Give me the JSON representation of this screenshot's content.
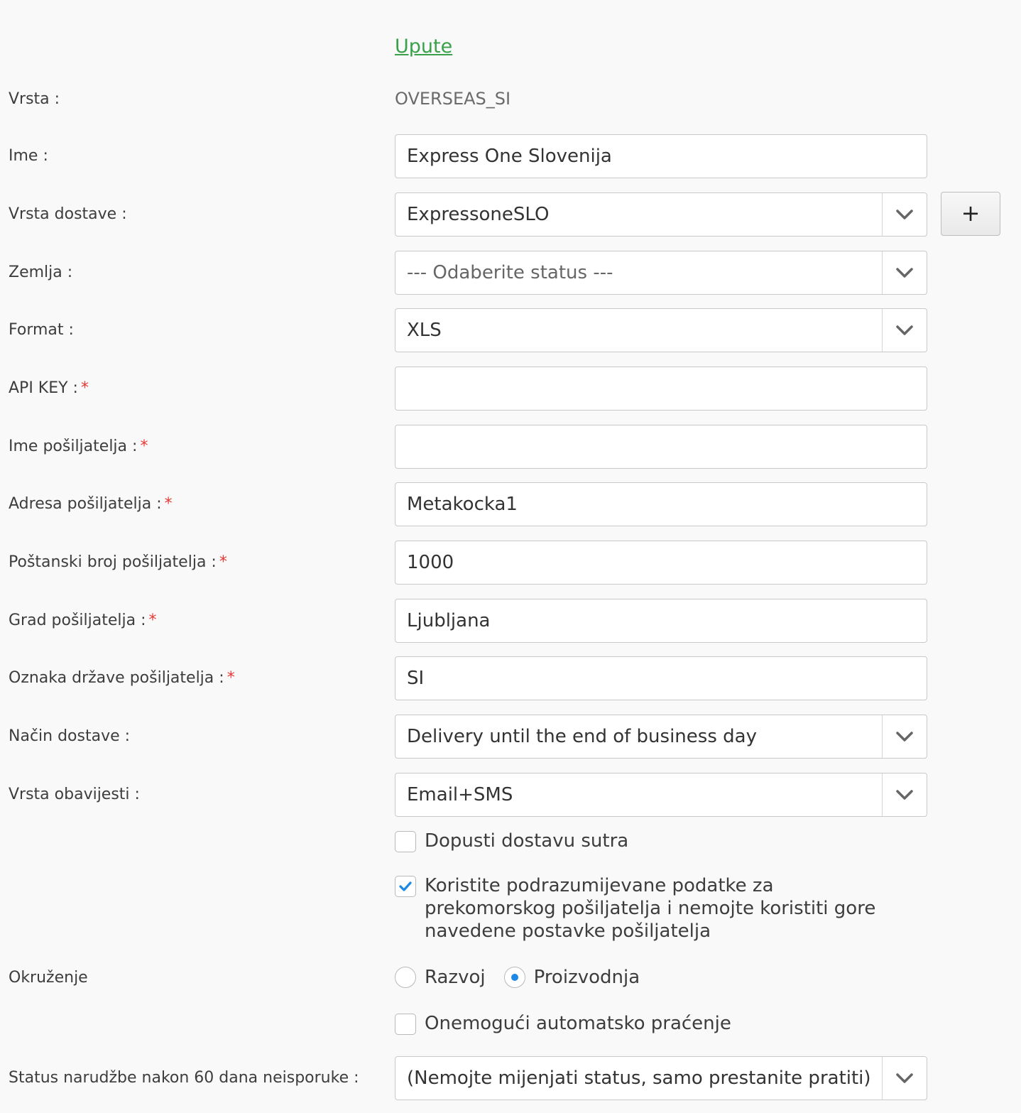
{
  "upute_link": "Upute",
  "vrsta": {
    "label": "Vrsta :",
    "value": "OVERSEAS_SI"
  },
  "ime": {
    "label": "Ime :",
    "value": "Express One Slovenija"
  },
  "vrsta_dostave": {
    "label": "Vrsta dostave :",
    "value": "ExpressoneSLO",
    "add_button": "+"
  },
  "zemlja": {
    "label": "Zemlja :",
    "placeholder": "--- Odaberite status ---"
  },
  "format": {
    "label": "Format :",
    "value": "XLS"
  },
  "api_key": {
    "label": "API KEY :",
    "required": "*",
    "value": ""
  },
  "ime_posiljatelja": {
    "label": "Ime pošiljatelja :",
    "required": "*",
    "value": ""
  },
  "adresa_posiljatelja": {
    "label": "Adresa pošiljatelja :",
    "required": "*",
    "value": "Metakocka1"
  },
  "postanski_broj": {
    "label": "Poštanski broj pošiljatelja :",
    "required": "*",
    "value": "1000"
  },
  "grad_posiljatelja": {
    "label": "Grad pošiljatelja :",
    "required": "*",
    "value": "Ljubljana"
  },
  "oznaka_drzave": {
    "label": "Oznaka države pošiljatelja :",
    "required": "*",
    "value": "SI"
  },
  "nacin_dostave": {
    "label": "Način dostave :",
    "value": "Delivery until the end of business day"
  },
  "vrsta_obavijesti": {
    "label": "Vrsta obavijesti :",
    "value": "Email+SMS"
  },
  "dopusti_dostavu": {
    "label": "Dopusti dostavu sutra",
    "checked": false
  },
  "koristite_podatke": {
    "label": "Koristite podrazumijevane podatke za prekomorskog pošiljatelja i nemojte koristiti gore navedene postavke pošiljatelja",
    "checked": true
  },
  "okruzenje": {
    "label": "Okruženje",
    "options": [
      "Razvoj",
      "Proizvodnja"
    ],
    "selected": "Proizvodnja"
  },
  "onemoguci_pracenje": {
    "label": "Onemogući automatsko praćenje",
    "checked": false
  },
  "status_narudzbe": {
    "label": "Status narudžbe nakon 60 dana neisporuke :",
    "value": "(Nemojte mijenjati status, samo prestanite pratiti)"
  },
  "colors": {
    "link": "#3aa14a",
    "required": "#e53935",
    "accent": "#1e88e5"
  }
}
